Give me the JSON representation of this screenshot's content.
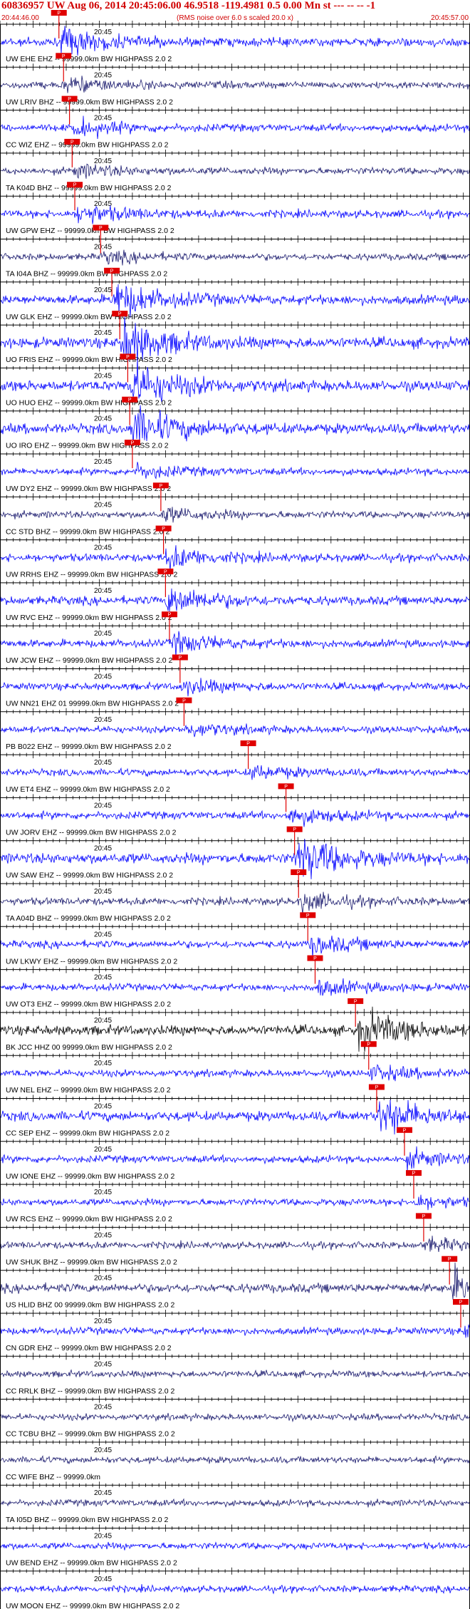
{
  "header": {
    "title": "60836957 UW Aug 06, 2014 20:45:06.00   46.9518 -119.4981  0.5 0.00 Mn st --- -- --   -1",
    "start_time": "20:44:46.00",
    "scale_note": "(RMS noise over 6.0 s scaled 20.0 x)",
    "end_time": "20:45:57.00"
  },
  "colors": {
    "text_red": "#d00000",
    "pick_red": "#e00000",
    "trace_blue": "#0000ff",
    "trace_navy": "#1a1a6e",
    "trace_black": "#000000",
    "axis": "#000000"
  },
  "chart_data": {
    "type": "seismogram",
    "time_axis_label": "20:45",
    "pick_marker_label": "P",
    "time_range_s": [
      0,
      71
    ],
    "series": [
      {
        "name": "UW EHE EHZ -- 99999.0km BW  HIGHPASS  2.0  2",
        "pick_s": 8.9,
        "color": "blue",
        "amplitude": 0.75
      },
      {
        "name": "UW LRIV BHZ -- 99999.0km BW  HIGHPASS  2.0  2",
        "pick_s": 9.6,
        "color": "navy",
        "amplitude": 0.4
      },
      {
        "name": "CC WIZ EHZ -- 99999.0km BW  HIGHPASS  2.0  2",
        "pick_s": 10.5,
        "color": "blue",
        "amplitude": 0.45
      },
      {
        "name": "TA K04D BHZ -- 99999.0km BW  HIGHPASS  2.0  2",
        "pick_s": 10.9,
        "color": "navy",
        "amplitude": 0.35
      },
      {
        "name": "UW GPW EHZ -- 99999.0km BW  HIGHPASS  2.0  2",
        "pick_s": 11.3,
        "color": "blue",
        "amplitude": 0.55
      },
      {
        "name": "TA I04A BHZ -- 99999.0km BW  HIGHPASS  2.0  2",
        "pick_s": 15.2,
        "color": "navy",
        "amplitude": 0.3
      },
      {
        "name": "UW GLK EHZ -- 99999.0km BW  HIGHPASS  2.0  2",
        "pick_s": 16.9,
        "color": "blue",
        "amplitude": 1.0
      },
      {
        "name": "UO FRIS EHZ -- 99999.0km BW  HIGHPASS  2.0  2",
        "pick_s": 18.1,
        "color": "blue",
        "amplitude": 1.3
      },
      {
        "name": "UO HUO EHZ -- 99999.0km BW  HIGHPASS  2.0  2",
        "pick_s": 19.3,
        "color": "blue",
        "amplitude": 1.3
      },
      {
        "name": "UO IRO EHZ -- 99999.0km BW  HIGHPASS  2.0  2",
        "pick_s": 19.6,
        "color": "blue",
        "amplitude": 1.2
      },
      {
        "name": "UW DY2 EHZ -- 99999.0km BW  HIGHPASS  2.0  2",
        "pick_s": 20.0,
        "color": "blue",
        "amplitude": 0.35
      },
      {
        "name": "CC STD BHZ -- 99999.0km BW  HIGHPASS  2.0  2",
        "pick_s": 24.3,
        "color": "navy",
        "amplitude": 0.35
      },
      {
        "name": "UW RRHS EHZ -- 99999.0km BW  HIGHPASS  2.0  2",
        "pick_s": 24.7,
        "color": "blue",
        "amplitude": 0.6
      },
      {
        "name": "UW RVC EHZ -- 99999.0km BW  HIGHPASS  2.0  2",
        "pick_s": 25.0,
        "color": "blue",
        "amplitude": 0.8
      },
      {
        "name": "UW JCW EHZ -- 99999.0km BW  HIGHPASS  2.0  2",
        "pick_s": 25.6,
        "color": "blue",
        "amplitude": 0.55
      },
      {
        "name": "UW NN21 EHZ 01 99999.0km BW  HIGHPASS  2.0  2",
        "pick_s": 27.2,
        "color": "blue",
        "amplitude": 0.4
      },
      {
        "name": "PB B022 EHZ -- 99999.0km BW  HIGHPASS  2.0  2",
        "pick_s": 27.8,
        "color": "blue",
        "amplitude": 0.35
      },
      {
        "name": "UW ET4 EHZ -- 99999.0km BW  HIGHPASS  2.0  2",
        "pick_s": 37.5,
        "color": "blue",
        "amplitude": 0.35
      },
      {
        "name": "UW JORV EHZ -- 99999.0km BW  HIGHPASS  2.0  2",
        "pick_s": 43.2,
        "color": "blue",
        "amplitude": 0.5
      },
      {
        "name": "UW SAW EHZ -- 99999.0km BW  HIGHPASS  2.0  2",
        "pick_s": 44.5,
        "color": "blue",
        "amplitude": 1.3
      },
      {
        "name": "TA A04D BHZ -- 99999.0km BW  HIGHPASS  2.0  2",
        "pick_s": 45.1,
        "color": "navy",
        "amplitude": 0.5
      },
      {
        "name": "UW LKWY EHZ -- 99999.0km BW  HIGHPASS  2.0  2",
        "pick_s": 46.5,
        "color": "blue",
        "amplitude": 0.5
      },
      {
        "name": "UW OT3 EHZ -- 99999.0km BW  HIGHPASS  2.0  2",
        "pick_s": 47.6,
        "color": "blue",
        "amplitude": 0.4
      },
      {
        "name": "BK JCC HHZ 00 99999.0km BW  HIGHPASS  2.0  2",
        "pick_s": 53.7,
        "color": "black",
        "amplitude": 1.1
      },
      {
        "name": "UW NEL EHZ -- 99999.0km BW  HIGHPASS  2.0  2",
        "pick_s": 55.7,
        "color": "blue",
        "amplitude": 0.4
      },
      {
        "name": "CC SEP EHZ -- 99999.0km BW  HIGHPASS  2.0  2",
        "pick_s": 56.9,
        "color": "blue",
        "amplitude": 1.1
      },
      {
        "name": "UW IONE EHZ -- 99999.0km BW  HIGHPASS  2.0  2",
        "pick_s": 61.1,
        "color": "blue",
        "amplitude": 0.45
      },
      {
        "name": "UW RCS EHZ -- 99999.0km BW  HIGHPASS  2.0  2",
        "pick_s": 62.5,
        "color": "blue",
        "amplitude": 0.35
      },
      {
        "name": "UW SHUK BHZ -- 99999.0km BW  HIGHPASS  2.0  2",
        "pick_s": 64.0,
        "color": "navy",
        "amplitude": 0.35
      },
      {
        "name": "US HLID BHZ 00 99999.0km BW  HIGHPASS  2.0  2",
        "pick_s": 67.9,
        "color": "navy",
        "amplitude": 0.9
      },
      {
        "name": "CN GDR EHZ -- 99999.0km BW  HIGHPASS  2.0  2",
        "pick_s": 69.6,
        "color": "blue",
        "amplitude": 0.4
      },
      {
        "name": "CC RRLK BHZ -- 99999.0km BW  HIGHPASS  2.0  2",
        "pick_s": null,
        "color": "navy",
        "amplitude": 0.25
      },
      {
        "name": "CC TCBU BHZ -- 99999.0km BW  HIGHPASS  2.0  2",
        "pick_s": null,
        "color": "navy",
        "amplitude": 0.25
      },
      {
        "name": "CC WIFE BHZ -- 99999.0km",
        "pick_s": null,
        "color": "navy",
        "amplitude": 0.25
      },
      {
        "name": "TA I05D BHZ -- 99999.0km BW  HIGHPASS  2.0  2",
        "pick_s": null,
        "color": "navy",
        "amplitude": 0.25
      },
      {
        "name": "UW BEND EHZ -- 99999.0km BW  HIGHPASS  2.0  2",
        "pick_s": null,
        "color": "blue",
        "amplitude": 0.3
      },
      {
        "name": "UW MOON EHZ -- 99999.0km BW  HIGHPASS  2.0  2",
        "pick_s": null,
        "color": "blue",
        "amplitude": 0.3
      }
    ]
  }
}
